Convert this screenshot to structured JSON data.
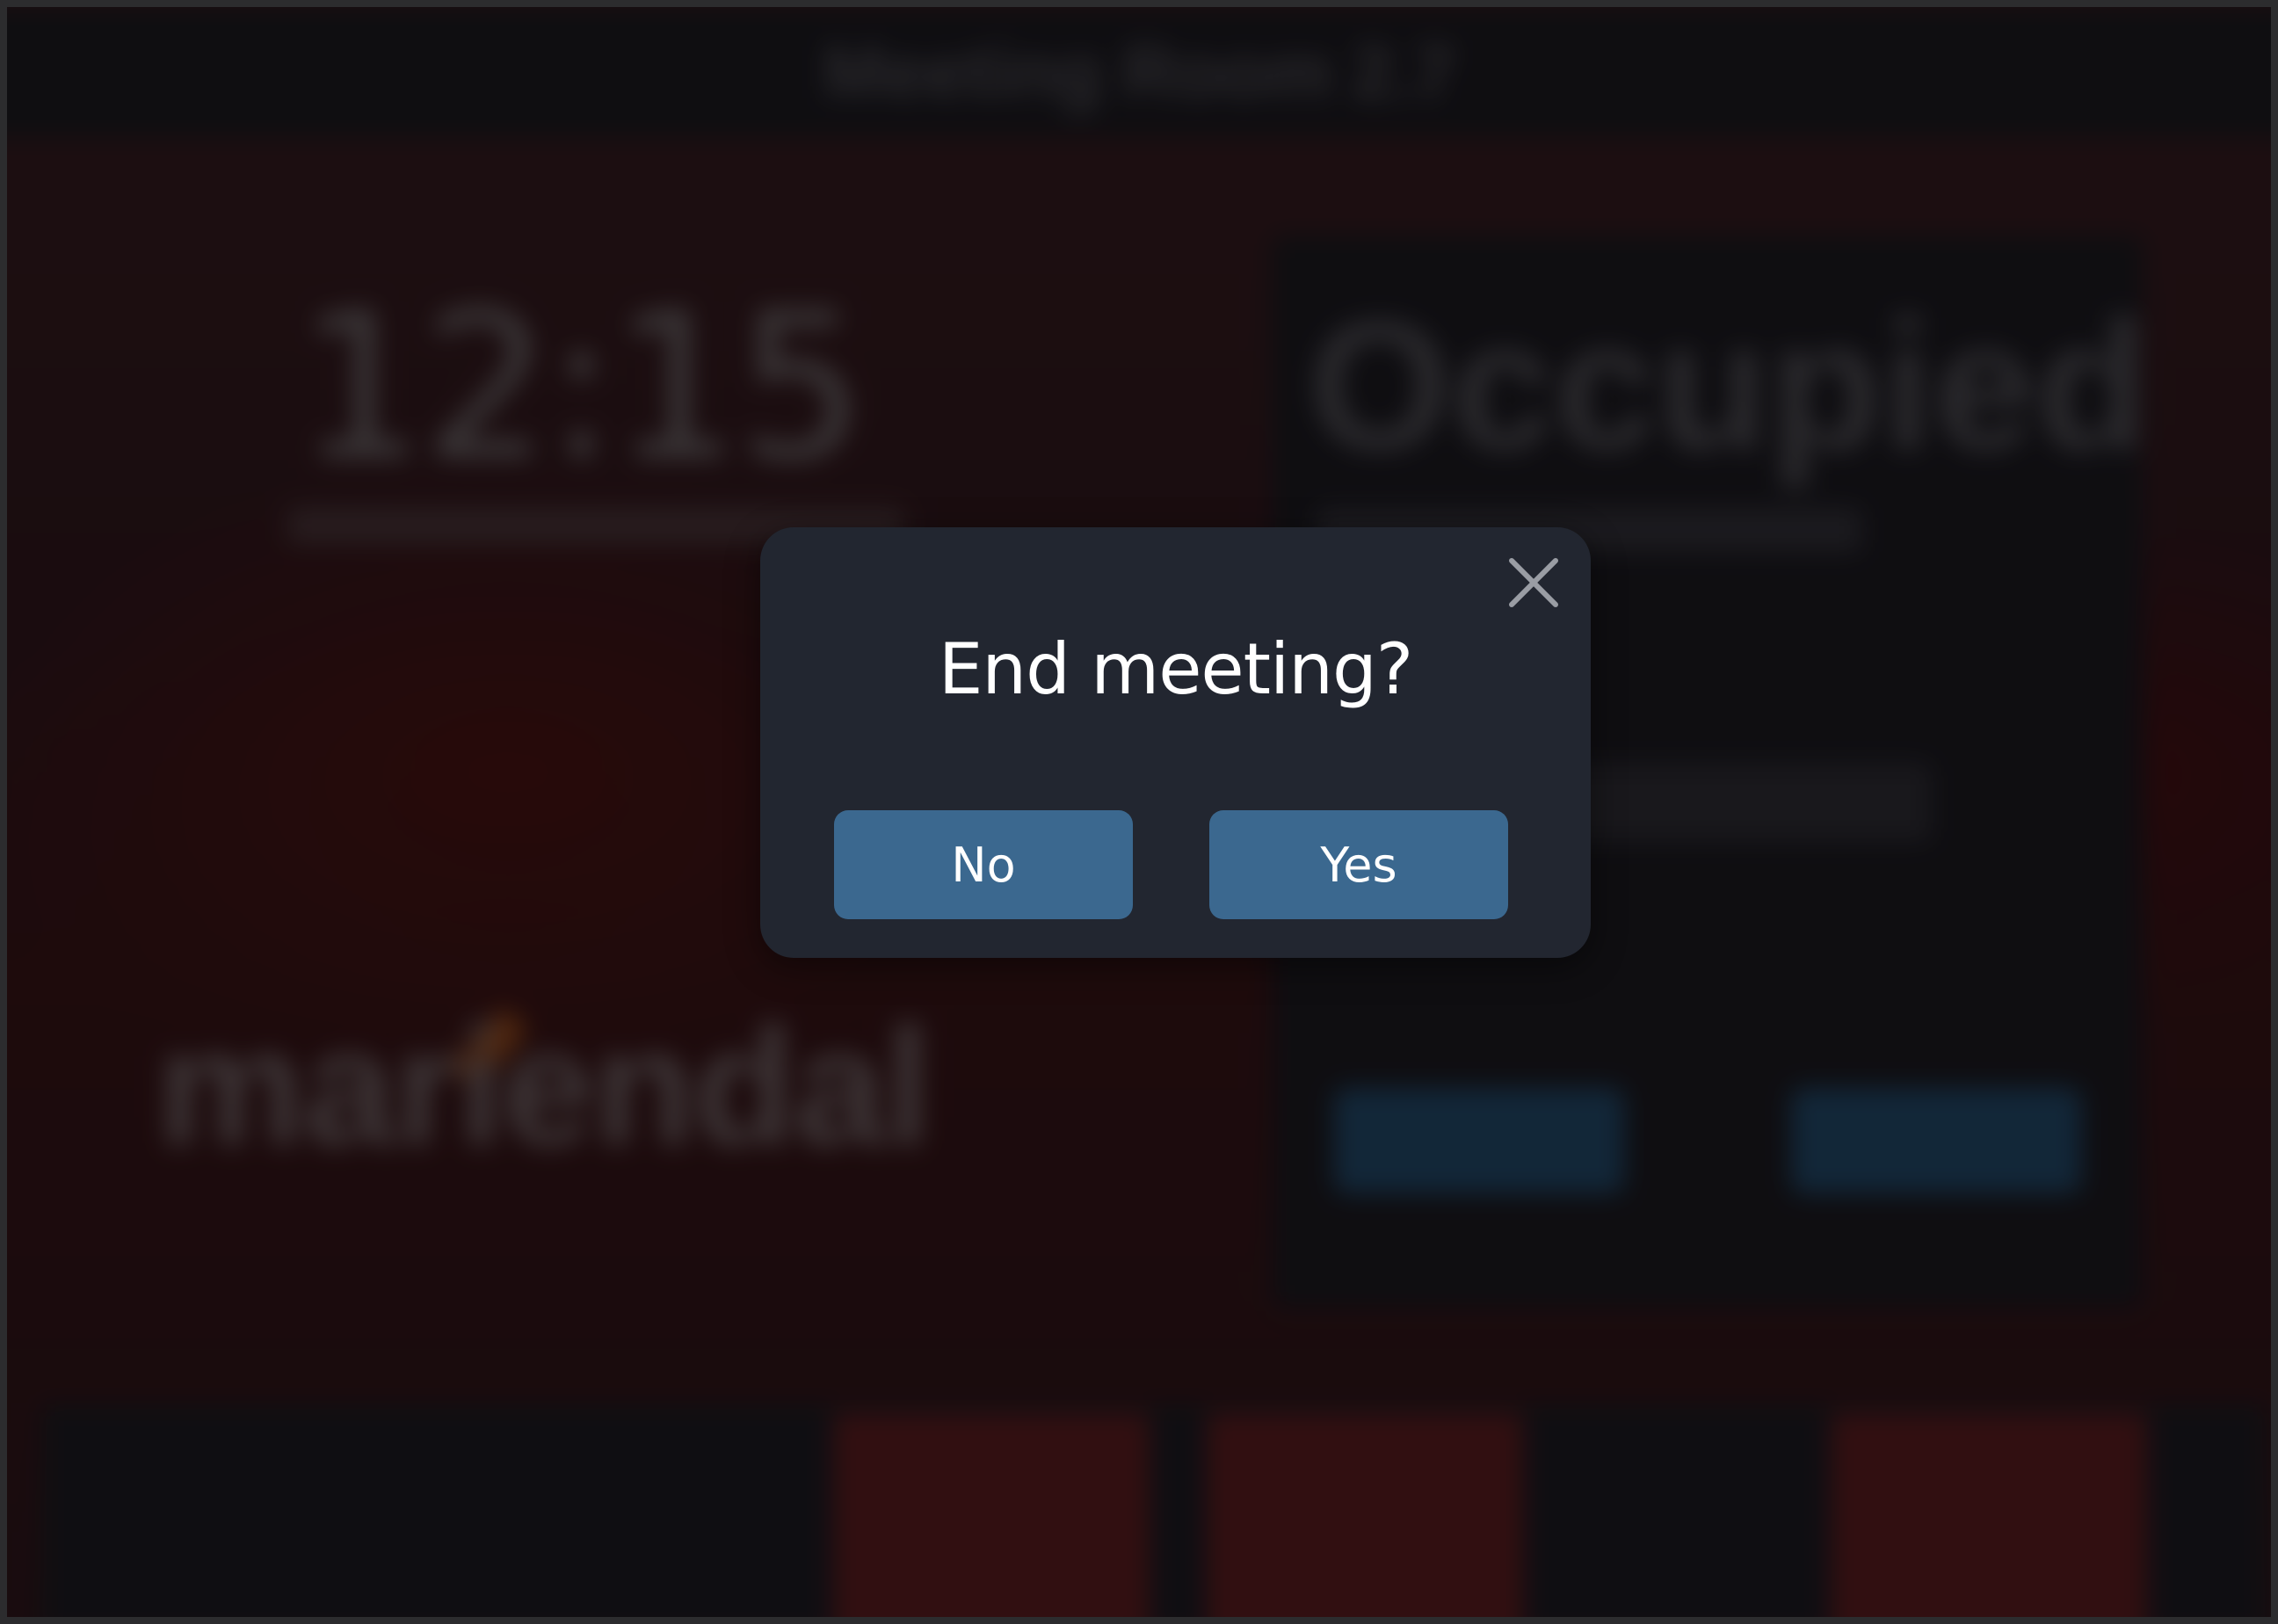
{
  "background": {
    "room_name": "Meeting Room 2.7",
    "clock": "12:15",
    "logo_text": "mariendal",
    "status": "Occupied"
  },
  "dialog": {
    "title": "End meeting?",
    "close_icon": "close-icon",
    "buttons": {
      "no_label": "No",
      "yes_label": "Yes"
    }
  },
  "colors": {
    "dialog_bg": "#222630",
    "button_bg": "#3b688f",
    "occupied_accent": "#4a1416"
  }
}
